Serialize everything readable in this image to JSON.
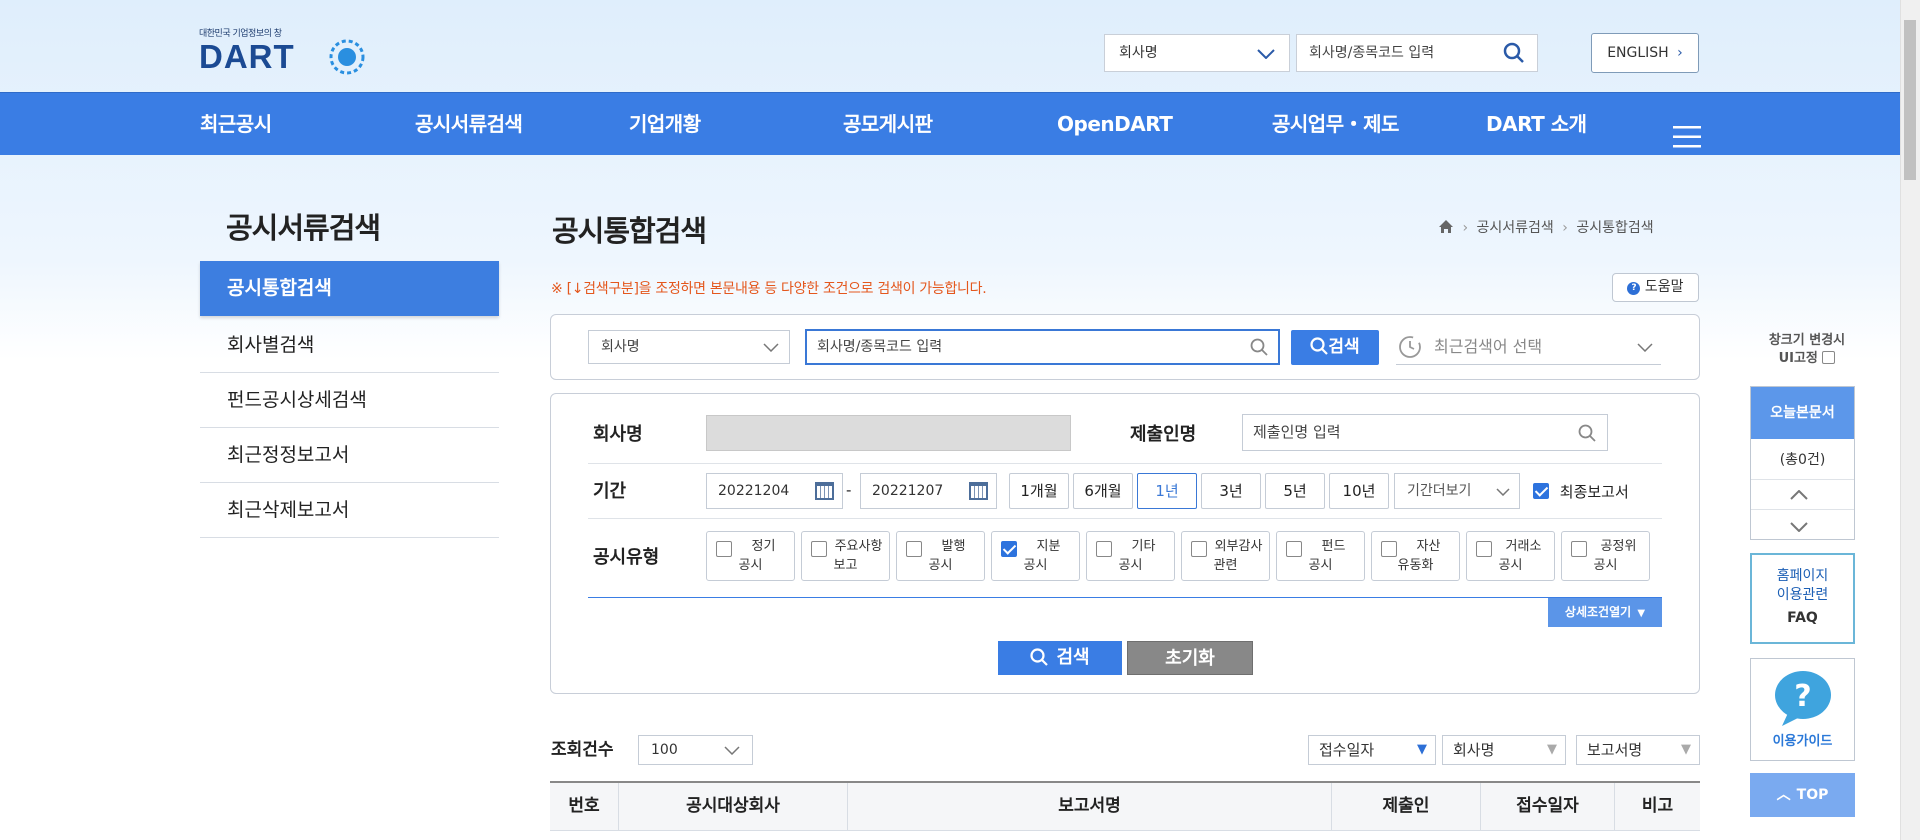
{
  "header": {
    "logo_tagline": "대한민국 기업정보의 창",
    "logo_text": "DART",
    "search_select": "회사명",
    "search_placeholder": "회사명/종목코드 입력",
    "english_label": "ENGLISH"
  },
  "nav": [
    "최근공시",
    "공시서류검색",
    "기업개황",
    "공모게시판",
    "OpenDART",
    "공시업무・제도",
    "DART 소개"
  ],
  "sidebar": {
    "title": "공시서류검색",
    "items": [
      "공시통합검색",
      "회사별검색",
      "펀드공시상세검색",
      "최근정정보고서",
      "최근삭제보고서"
    ]
  },
  "main": {
    "title": "공시통합검색",
    "breadcrumb": [
      "공시서류검색",
      "공시통합검색"
    ],
    "notice": "※ [↓검색구분]을 조정하면 본문내용 등 다양한 조건으로 검색이 가능합니다.",
    "help_label": "도움말"
  },
  "search": {
    "select_value": "회사명",
    "input_placeholder": "회사명/종목코드 입력",
    "button_label": "검색",
    "recent_placeholder": "최근검색어 선택"
  },
  "detail": {
    "company_label": "회사명",
    "submitter_label": "제출인명",
    "submitter_placeholder": "제출인명 입력",
    "period_label": "기간",
    "date_from": "20221204",
    "date_to": "20221207",
    "period_buttons": [
      "1개월",
      "6개월",
      "1년",
      "3년",
      "5년",
      "10년"
    ],
    "period_selected": "1년",
    "period_more": "기간더보기",
    "final_report_label": "최종보고서",
    "final_report_checked": true,
    "type_label": "공시유형",
    "types": [
      {
        "line1": "정기",
        "line2": "공시",
        "checked": false
      },
      {
        "line1": "주요사항",
        "line2": "보고",
        "checked": false
      },
      {
        "line1": "발행",
        "line2": "공시",
        "checked": false
      },
      {
        "line1": "지분",
        "line2": "공시",
        "checked": true
      },
      {
        "line1": "기타",
        "line2": "공시",
        "checked": false
      },
      {
        "line1": "외부감사",
        "line2": "관련",
        "checked": false
      },
      {
        "line1": "펀드",
        "line2": "공시",
        "checked": false
      },
      {
        "line1": "자산",
        "line2": "유동화",
        "checked": false
      },
      {
        "line1": "거래소",
        "line2": "공시",
        "checked": false
      },
      {
        "line1": "공정위",
        "line2": "공시",
        "checked": false
      }
    ],
    "more_conditions": "상세조건열기",
    "search_button": "검색",
    "reset_button": "초기화"
  },
  "results": {
    "count_label": "조회건수",
    "count_value": "100",
    "sort_options": [
      "접수일자",
      "회사명",
      "보고서명"
    ],
    "columns": [
      "번호",
      "공시대상회사",
      "보고서명",
      "제출인",
      "접수일자",
      "비고"
    ]
  },
  "quick_panel": {
    "resize_line1": "창크기 변경시",
    "resize_line2": "UI고정",
    "today_label": "오늘본문서",
    "today_count": "(총0건)",
    "faq_line1": "홈페이지",
    "faq_line2": "이용관련",
    "faq_line3": "FAQ",
    "guide_label": "이용가이드",
    "top_label": "TOP"
  },
  "colors": {
    "nav_blue": "#3a7de4",
    "notice_orange": "#e4571d",
    "reset_gray": "#888888"
  }
}
